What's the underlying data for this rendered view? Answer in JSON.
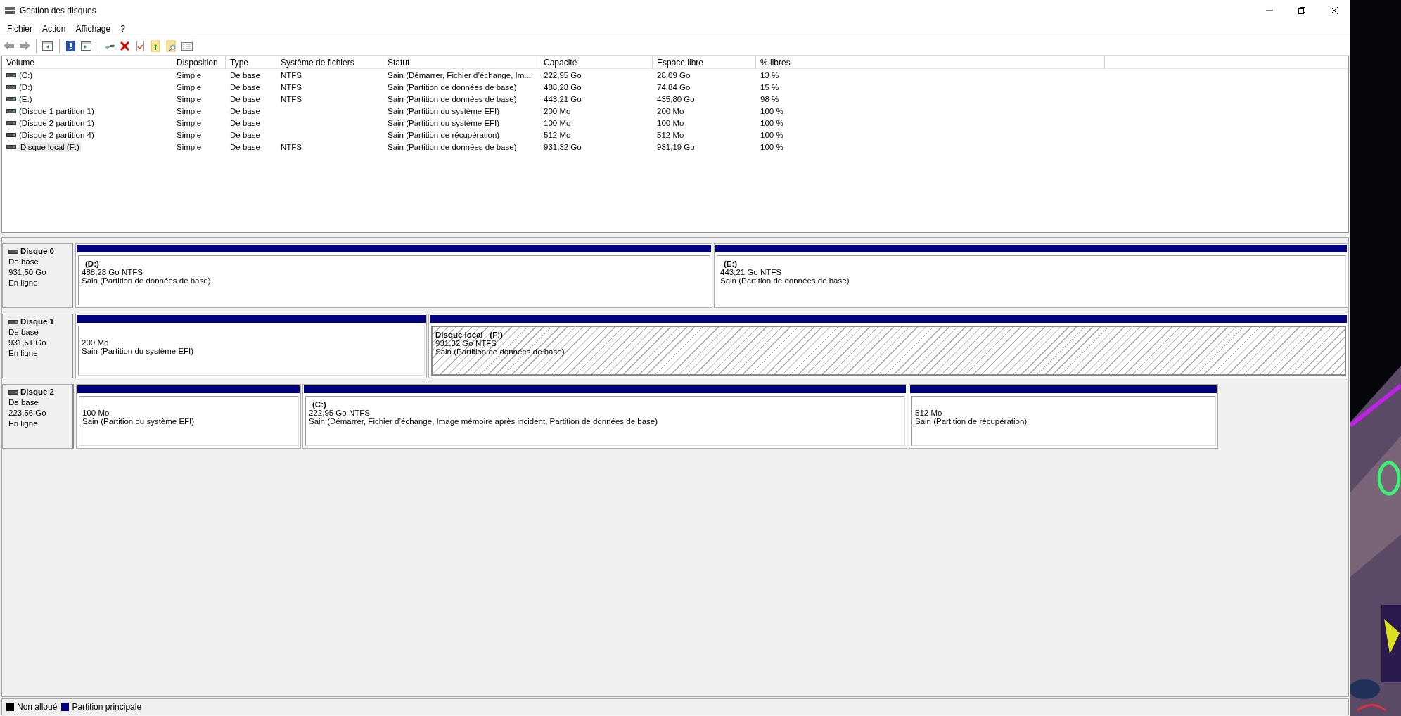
{
  "window": {
    "title": "Gestion des disques"
  },
  "menu": [
    "Fichier",
    "Action",
    "Affichage",
    "?"
  ],
  "table": {
    "columns": [
      "Volume",
      "Disposition",
      "Type",
      "Système de fichiers",
      "Statut",
      "Capacité",
      "Espace libre",
      "% libres"
    ],
    "rows": [
      {
        "cells": [
          "(C:)",
          "Simple",
          "De base",
          "NTFS",
          "Sain (Démarrer, Fichier d’échange, Im...",
          "222,95 Go",
          "28,09 Go",
          "13 %"
        ],
        "selected": false
      },
      {
        "cells": [
          "(D:)",
          "Simple",
          "De base",
          "NTFS",
          "Sain (Partition de données de base)",
          "488,28 Go",
          "74,84 Go",
          "15 %"
        ],
        "selected": false
      },
      {
        "cells": [
          "(E:)",
          "Simple",
          "De base",
          "NTFS",
          "Sain (Partition de données de base)",
          "443,21 Go",
          "435,80 Go",
          "98 %"
        ],
        "selected": false
      },
      {
        "cells": [
          "(Disque 1 partition 1)",
          "Simple",
          "De base",
          "",
          "Sain (Partition du système EFI)",
          "200 Mo",
          "200 Mo",
          "100 %"
        ],
        "selected": false
      },
      {
        "cells": [
          "(Disque 2 partition 1)",
          "Simple",
          "De base",
          "",
          "Sain (Partition du système EFI)",
          "100 Mo",
          "100 Mo",
          "100 %"
        ],
        "selected": false
      },
      {
        "cells": [
          "(Disque 2 partition 4)",
          "Simple",
          "De base",
          "",
          "Sain (Partition de récupération)",
          "512 Mo",
          "512 Mo",
          "100 %"
        ],
        "selected": false
      },
      {
        "cells": [
          "Disque local  (F:)",
          "Simple",
          "De base",
          "NTFS",
          "Sain (Partition de données de base)",
          "931,32 Go",
          "931,19 Go",
          "100 %"
        ],
        "selected": true
      }
    ]
  },
  "disks": [
    {
      "name": "Disque 0",
      "type": "De base",
      "size": "931,50 Go",
      "status": "En ligne",
      "partitions": [
        {
          "label": "(D:)",
          "size": "488,28 Go NTFS",
          "status": "Sain (Partition de données de base)",
          "selected": false
        },
        {
          "label": "(E:)",
          "size": "443,21 Go NTFS",
          "status": "Sain (Partition de données de base)",
          "selected": false
        }
      ]
    },
    {
      "name": "Disque 1",
      "type": "De base",
      "size": "931,51 Go",
      "status": "En ligne",
      "partitions": [
        {
          "size": "200 Mo",
          "status": "Sain (Partition du système EFI)",
          "selected": false
        },
        {
          "label": "Disque local   (F:)",
          "size": "931,32 Go NTFS",
          "status": "Sain (Partition de données de base)",
          "selected": true
        }
      ]
    },
    {
      "name": "Disque 2",
      "type": "De base",
      "size": "223,56 Go",
      "status": "En ligne",
      "partitions": [
        {
          "size": "100 Mo",
          "status": "Sain (Partition du système EFI)",
          "selected": false
        },
        {
          "label": "(C:)",
          "size": "222,95 Go NTFS",
          "status": "Sain (Démarrer, Fichier d’échange, Image mémoire après incident, Partition de données de base)",
          "selected": false
        },
        {
          "size": "512 Mo",
          "status": "Sain (Partition de récupération)",
          "selected": false
        }
      ]
    }
  ],
  "legend": [
    {
      "label": "Non alloué",
      "color": "#000000"
    },
    {
      "label": "Partition principale",
      "color": "#000080"
    }
  ]
}
